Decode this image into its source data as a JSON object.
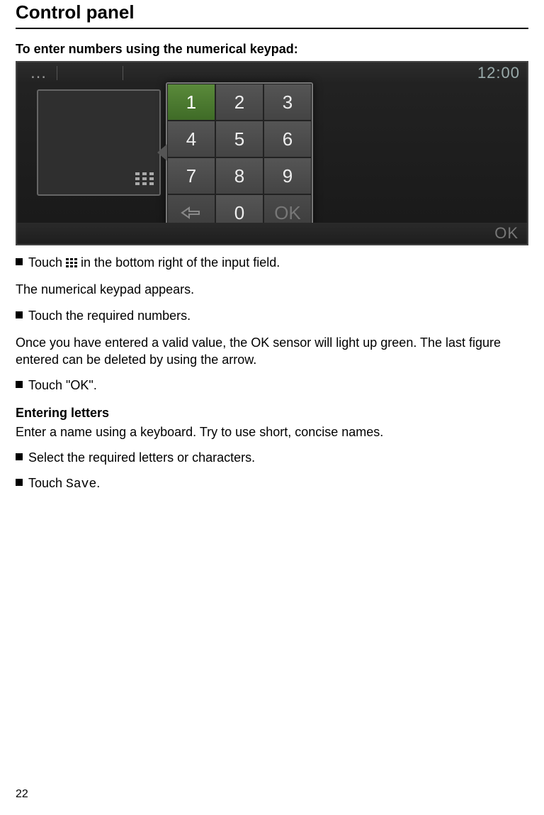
{
  "page": {
    "title": "Control panel",
    "subtitle": "To enter numbers using the numerical keypad:",
    "number": "22"
  },
  "device": {
    "top_ellipsis": "…",
    "time": "12:00",
    "keys": {
      "k1": "1",
      "k2": "2",
      "k3": "3",
      "k4": "4",
      "k5": "5",
      "k6": "6",
      "k7": "7",
      "k8": "8",
      "k9": "9",
      "k0": "0",
      "ok": "OK"
    },
    "bottom_ok": "OK"
  },
  "content": {
    "bullet1_a": "Touch ",
    "bullet1_b": " in the bottom right of the input field.",
    "p1": "The numerical keypad appears.",
    "bullet2": "Touch the required numbers.",
    "p2": "Once you have entered a valid value, the OK sensor will light up green. The last figure entered can be deleted by using the arrow.",
    "bullet3": "Touch \"OK\".",
    "sectionHead": "Entering letters",
    "p3": "Enter a name using a keyboard. Try to use short, concise names.",
    "bullet4": "Select the required letters or characters.",
    "bullet5_a": "Touch ",
    "bullet5_b": "Save",
    "bullet5_c": "."
  }
}
